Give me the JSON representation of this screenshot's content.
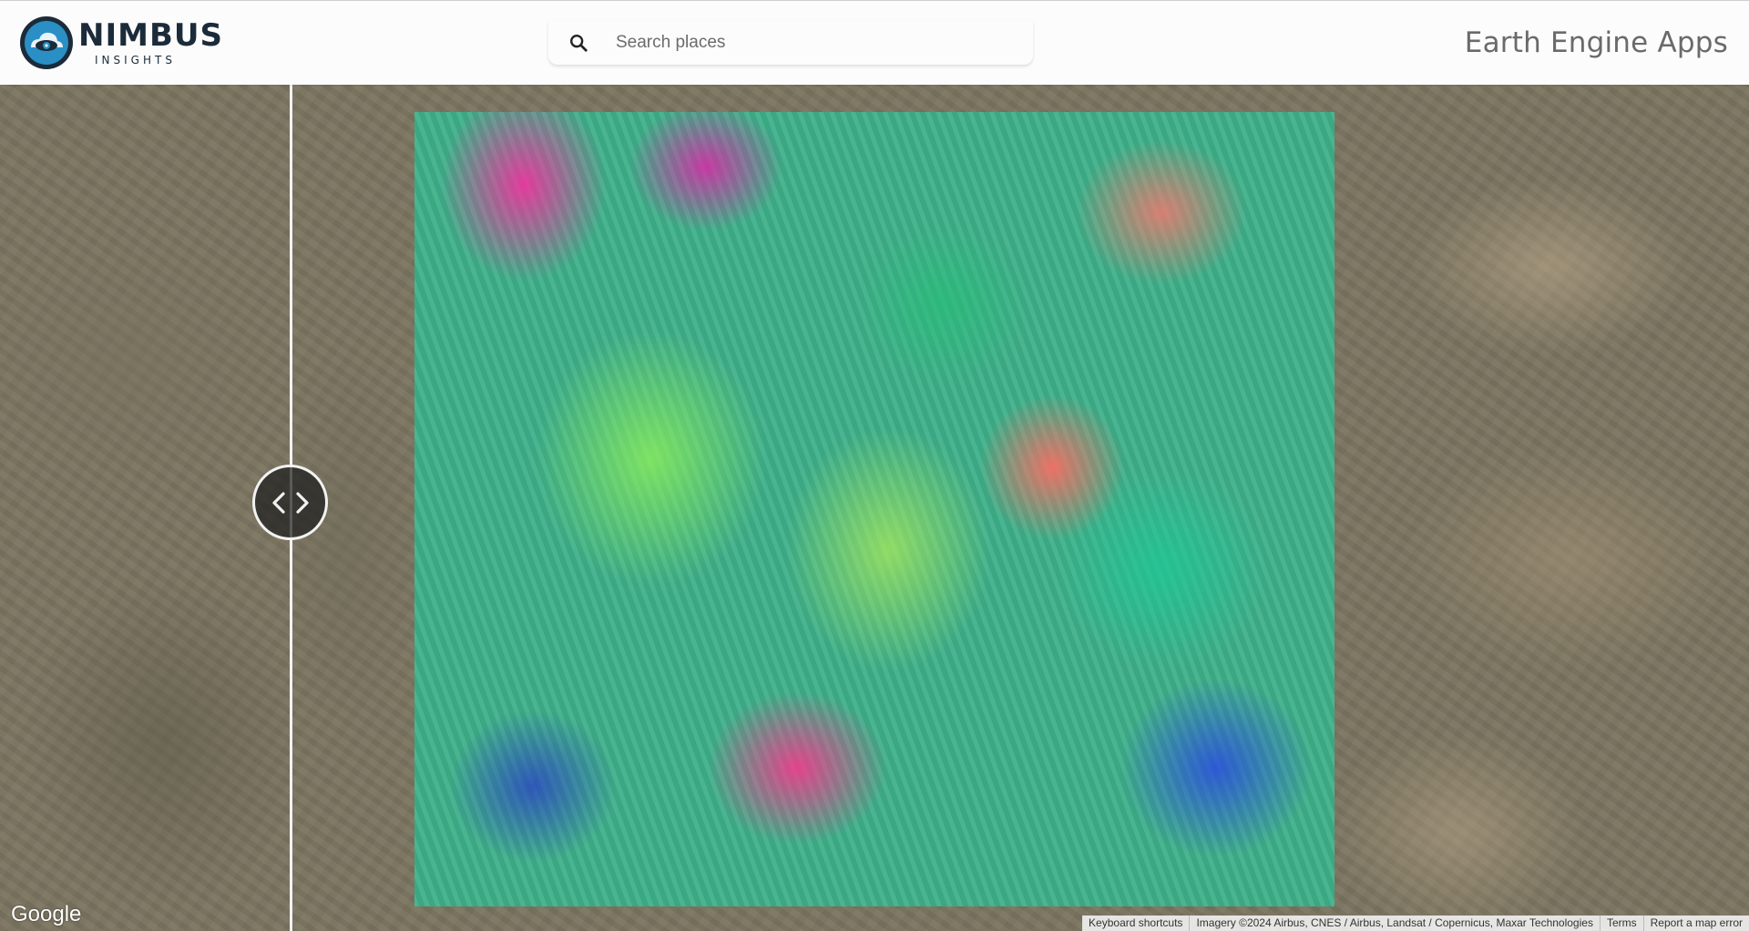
{
  "header": {
    "logo": {
      "name": "NIMBUS",
      "subtitle": "INSIGHTS",
      "icon": "cloud-eye-logo-icon",
      "colors": {
        "primary": "#1b2b3a",
        "accent": "#2a8fc4"
      }
    },
    "search": {
      "icon": "search-icon",
      "placeholder": "Search places",
      "value": ""
    },
    "title": "Earth Engine Apps"
  },
  "map": {
    "swipe_handle": {
      "icon": "chevron-left-right-icon"
    },
    "google_logo": "Google",
    "attribution": {
      "keyboard_shortcuts": "Keyboard shortcuts",
      "imagery": "Imagery ©2024 Airbus, CNES / Airbus, Landsat / Copernicus, Maxar Technologies",
      "terms": "Terms",
      "report": "Report a map error"
    }
  }
}
